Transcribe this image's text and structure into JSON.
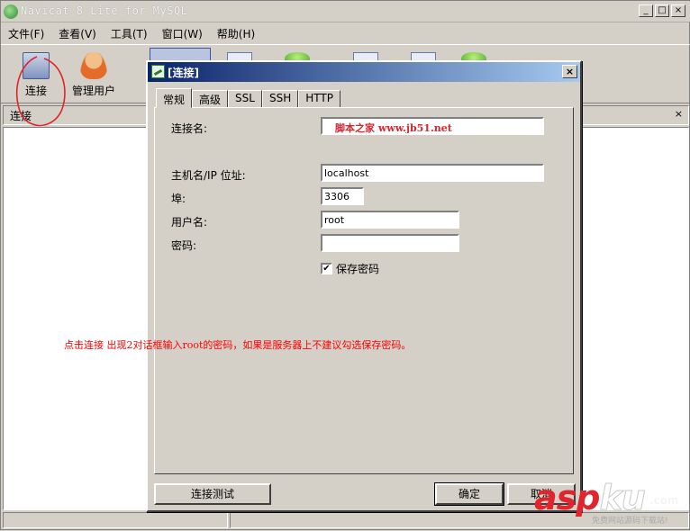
{
  "window": {
    "title": "Navicat 8 Lite for MySQL",
    "buttons": [
      "_",
      "□",
      "×"
    ]
  },
  "menu": [
    "文件(F)",
    "查看(V)",
    "工具(T)",
    "窗口(W)",
    "帮助(H)"
  ],
  "toolbar": {
    "connect_label": "连接",
    "manage_users_label": "管理用户"
  },
  "left_panel": {
    "header": "连接",
    "close": "×"
  },
  "dialog": {
    "title": "[连接]",
    "close": "×",
    "tabs": [
      "常规",
      "高级",
      "SSL",
      "SSH",
      "HTTP"
    ],
    "fields": {
      "conn_name_label": "连接名:",
      "conn_name_value": "脚本之家   www.jb51.net",
      "host_label": "主机名/IP 位址:",
      "host_value": "localhost",
      "port_label": "埠:",
      "port_value": "3306",
      "user_label": "用户名:",
      "user_value": "root",
      "password_label": "密码:",
      "password_value": ""
    },
    "save_password_label": "保存密码",
    "save_password_checked": "✔",
    "buttons": {
      "test": "连接测试",
      "ok": "确定",
      "cancel": "取消"
    }
  },
  "annotation": "点击连接 出现2对话框输入root的密码，如果是服务器上不建议勾选保存密码。",
  "watermark": {
    "main": "asp",
    "ku": "ku",
    "dotcom": ".com",
    "sub": "免费网站源码下载站!"
  },
  "colors": {
    "dialog_title_start": "#0a246a",
    "dialog_title_end": "#a6caf0",
    "annotation": "#ff0000",
    "circle_marks": "#e0242a"
  }
}
